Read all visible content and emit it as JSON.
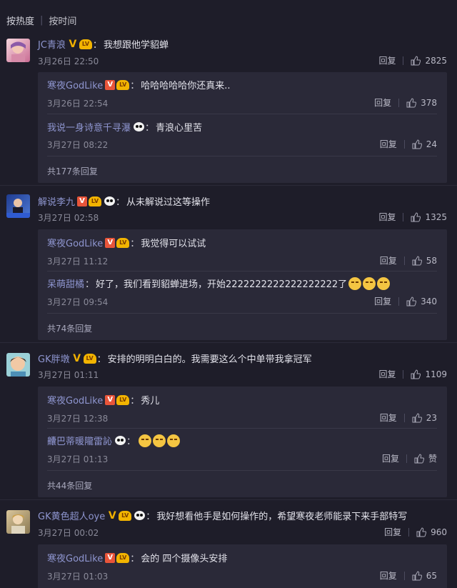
{
  "sort": {
    "hot": "按热度",
    "time": "按时间"
  },
  "comments": [
    {
      "user": "JC青浪",
      "text": "我想跟他学貂蝉",
      "time": "3月26日 22:50",
      "reply": "回复",
      "likes": "2825",
      "replies": [
        {
          "user": "寒夜GodLike",
          "text": "哈哈哈哈哈你还真来..",
          "time": "3月26日 22:54",
          "reply": "回复",
          "likes": "378"
        },
        {
          "user": "我说一身诗意千寻瀑",
          "text": "青浪心里苦",
          "time": "3月27日 08:22",
          "reply": "回复",
          "likes": "24"
        }
      ],
      "more": "共177条回复"
    },
    {
      "user": "解说李九",
      "text": "从未解说过这等操作",
      "time": "3月27日 02:58",
      "reply": "回复",
      "likes": "1325",
      "replies": [
        {
          "user": "寒夜GodLike",
          "text": "我觉得可以试试",
          "time": "3月27日 11:12",
          "reply": "回复",
          "likes": "58"
        },
        {
          "user": "呆萌甜橘",
          "text": "好了，我们看到貂蝉进场，开始2222222222222222222了",
          "time": "3月27日 09:54",
          "reply": "回复",
          "likes": "340"
        }
      ],
      "more": "共74条回复"
    },
    {
      "user": "GK胖墩",
      "text": "安排的明明白白的。我需要这么个中单带我拿冠军",
      "time": "3月27日 01:11",
      "reply": "回复",
      "likes": "1109",
      "replies": [
        {
          "user": "寒夜GodLike",
          "text": "秀儿",
          "time": "3月27日 12:38",
          "reply": "回复",
          "likes": "23"
        },
        {
          "user": "齉巴蒂暖隴雷訫",
          "text": "",
          "time": "3月27日 01:13",
          "reply": "回复",
          "likes": "赞"
        }
      ],
      "more": "共44条回复"
    },
    {
      "user": "GK黄色超人oye",
      "text": "我好想看他手是如何操作的，希望寒夜老师能录下来手部特写",
      "time": "3月27日 00:02",
      "reply": "回复",
      "likes": "960",
      "replies": [
        {
          "user": "寒夜GodLike",
          "text": "会的 四个摄像头安排",
          "time": "3月27日 01:03",
          "reply": "回复",
          "likes": "65"
        }
      ]
    }
  ]
}
